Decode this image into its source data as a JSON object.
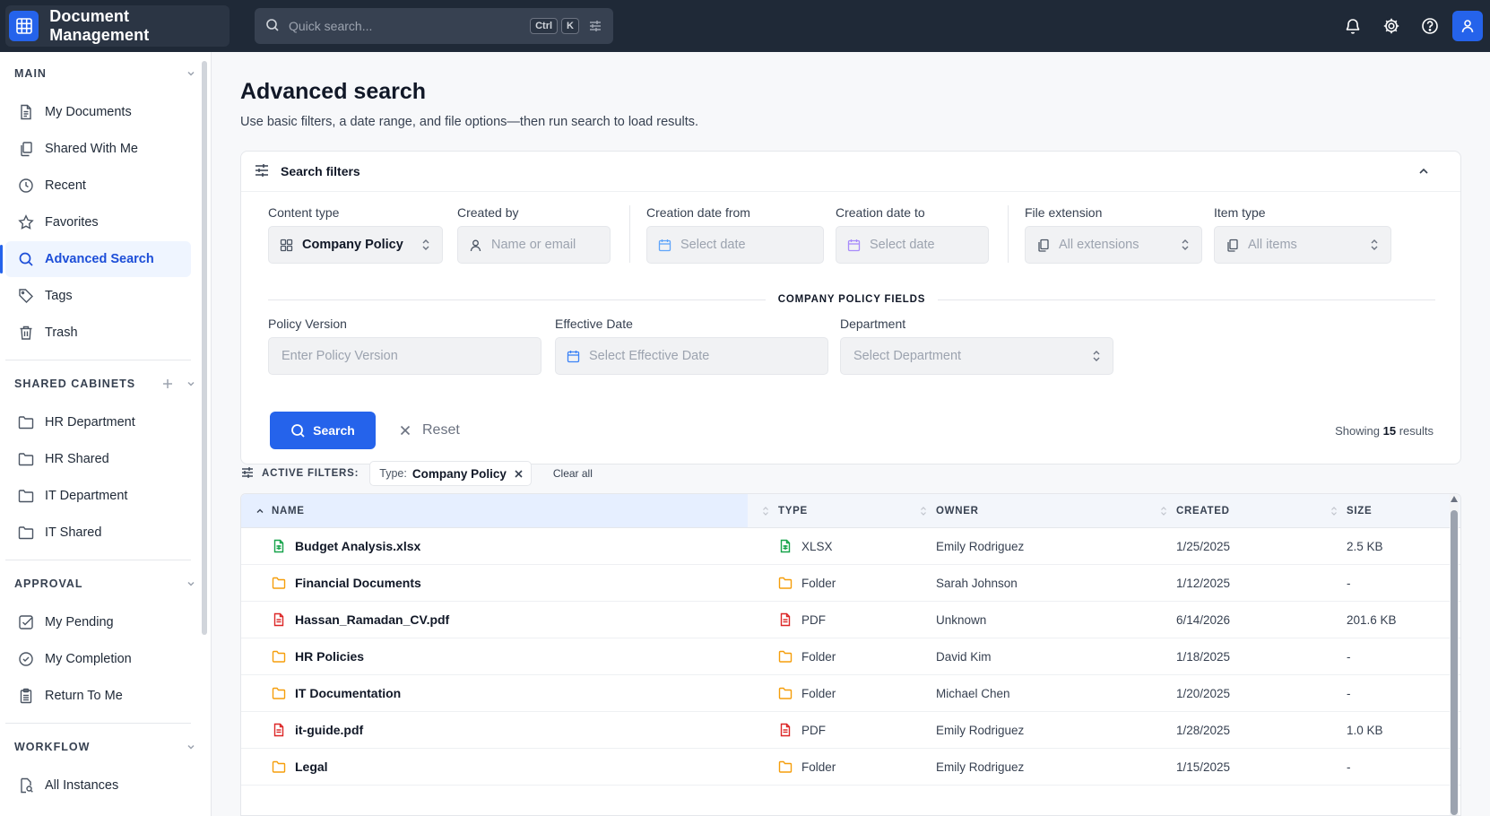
{
  "app": {
    "title": "Document Management"
  },
  "quick_search": {
    "placeholder": "Quick search...",
    "kbd_ctrl": "Ctrl",
    "kbd_k": "K"
  },
  "sidebar": {
    "main_title": "MAIN",
    "main_items": [
      {
        "label": "My Documents"
      },
      {
        "label": "Shared With Me"
      },
      {
        "label": "Recent"
      },
      {
        "label": "Favorites"
      },
      {
        "label": "Advanced Search"
      },
      {
        "label": "Tags"
      },
      {
        "label": "Trash"
      }
    ],
    "cabinets_title": "SHARED CABINETS",
    "cabinet_items": [
      {
        "label": "HR Department"
      },
      {
        "label": "HR Shared"
      },
      {
        "label": "IT Department"
      },
      {
        "label": "IT Shared"
      }
    ],
    "approval_title": "APPROVAL",
    "approval_items": [
      {
        "label": "My Pending"
      },
      {
        "label": "My Completion"
      },
      {
        "label": "Return To Me"
      }
    ],
    "workflow_title": "WORKFLOW",
    "workflow_items": [
      {
        "label": "All Instances"
      }
    ]
  },
  "page": {
    "title": "Advanced search",
    "subtitle": "Use basic filters, a date range, and file options—then run search to load results."
  },
  "filters": {
    "title": "Search filters",
    "content_type_label": "Content type",
    "content_type_value": "Company Policy",
    "created_by_label": "Created by",
    "created_by_placeholder": "Name or email",
    "date_from_label": "Creation date from",
    "date_from_placeholder": "Select date",
    "date_to_label": "Creation date to",
    "date_to_placeholder": "Select date",
    "extension_label": "File extension",
    "extension_value": "All extensions",
    "item_type_label": "Item type",
    "item_type_value": "All items",
    "section_title": "COMPANY POLICY FIELDS",
    "policy_version_label": "Policy Version",
    "policy_version_placeholder": "Enter Policy Version",
    "effective_date_label": "Effective Date",
    "effective_date_placeholder": "Select Effective Date",
    "department_label": "Department",
    "department_placeholder": "Select Department",
    "search_button": "Search",
    "reset_button": "Reset",
    "showing_prefix": "Showing",
    "showing_count": "15",
    "showing_suffix": "results"
  },
  "active_filters": {
    "label": "ACTIVE FILTERS:",
    "chip_key": "Type:",
    "chip_value": "Company Policy",
    "clear_all": "Clear all"
  },
  "table": {
    "columns": [
      "NAME",
      "TYPE",
      "OWNER",
      "CREATED",
      "SIZE"
    ],
    "rows": [
      {
        "name": "Budget Analysis.xlsx",
        "type": "XLSX",
        "owner": "Emily Rodriguez",
        "created": "1/25/2025",
        "size": "2.5 KB",
        "icon": "xlsx-icon"
      },
      {
        "name": "Financial Documents",
        "type": "Folder",
        "owner": "Sarah Johnson",
        "created": "1/12/2025",
        "size": "-",
        "icon": "folder-icon"
      },
      {
        "name": "Hassan_Ramadan_CV.pdf",
        "type": "PDF",
        "owner": "Unknown",
        "created": "6/14/2026",
        "size": "201.6 KB",
        "icon": "pdf-icon"
      },
      {
        "name": "HR Policies",
        "type": "Folder",
        "owner": "David Kim",
        "created": "1/18/2025",
        "size": "-",
        "icon": "folder-icon"
      },
      {
        "name": "IT Documentation",
        "type": "Folder",
        "owner": "Michael Chen",
        "created": "1/20/2025",
        "size": "-",
        "icon": "folder-icon"
      },
      {
        "name": "it-guide.pdf",
        "type": "PDF",
        "owner": "Emily Rodriguez",
        "created": "1/28/2025",
        "size": "1.0 KB",
        "icon": "pdf-icon"
      },
      {
        "name": "Legal",
        "type": "Folder",
        "owner": "Emily Rodriguez",
        "created": "1/15/2025",
        "size": "-",
        "icon": "folder-icon"
      }
    ]
  },
  "colors": {
    "accent": "#2563eb",
    "topbar": "#1f2937",
    "folder": "#f59e0b",
    "pdf": "#dc2626",
    "xlsx": "#16a34a"
  }
}
